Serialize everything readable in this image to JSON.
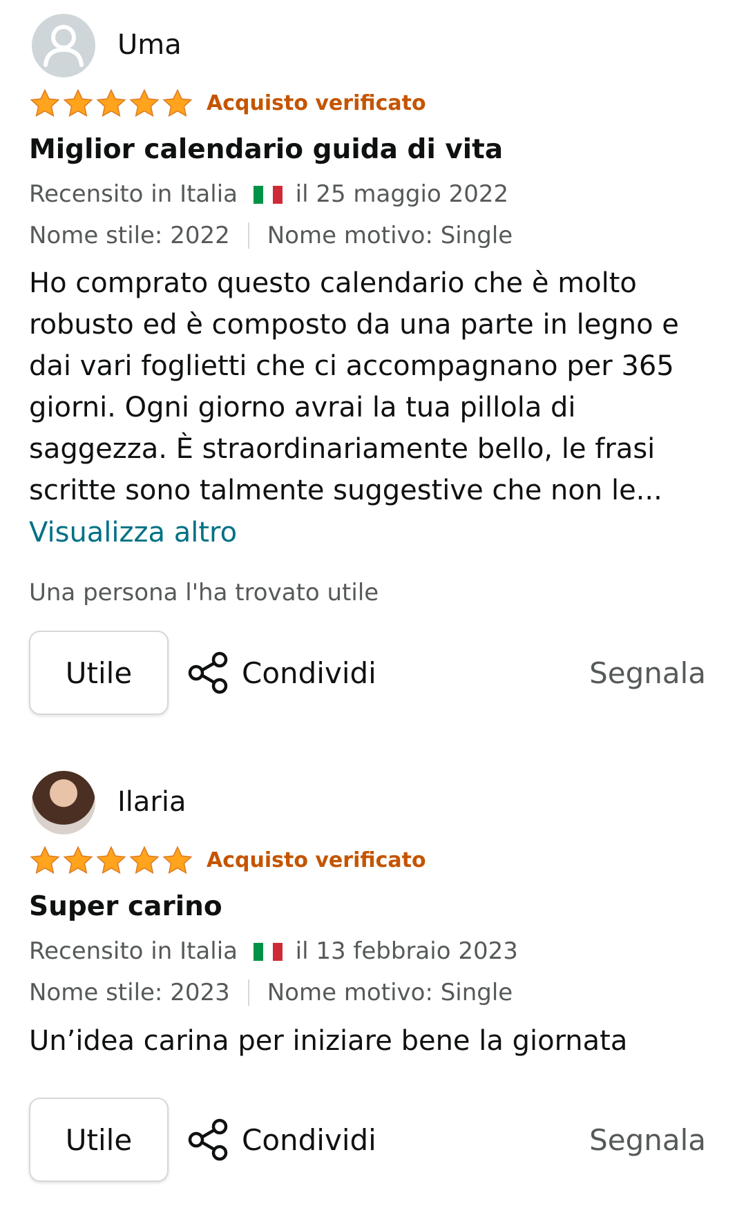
{
  "reviews": [
    {
      "author": "Uma",
      "avatar": "default-user-icon",
      "rating": 5,
      "verified": "Acquisto verificato",
      "title": "Miglior calendario guida di vita",
      "reviewed_prefix": "Recensito in Italia",
      "date": "il 25 maggio 2022",
      "style": "Nome stile: 2022",
      "pattern": "Nome motivo: Single",
      "body": "Ho comprato questo calendario che è molto robusto ed è composto da una parte in legno e dai vari foglietti che ci accompagnano per 365 giorni. Ogni giorno avrai la tua pillola di saggezza. È straordinariamente bello, le frasi scritte sono talmente suggestive che non le...",
      "more_link": "Visualizza altro",
      "helpful_text": "Una persona l'ha trovato utile",
      "helpful_button": "Utile",
      "share_label": "Condividi",
      "report_label": "Segnala"
    },
    {
      "author": "Ilaria",
      "avatar": "profile-photo",
      "rating": 5,
      "verified": "Acquisto verificato",
      "title": "Super carino",
      "reviewed_prefix": "Recensito in Italia",
      "date": "il 13 febbraio 2023",
      "style": "Nome stile: 2023",
      "pattern": "Nome motivo: Single",
      "body": "Un’idea carina per iniziare bene la giornata",
      "helpful_button": "Utile",
      "share_label": "Condividi",
      "report_label": "Segnala"
    }
  ],
  "colors": {
    "star": "#ffa41c",
    "verified": "#c45500",
    "link": "#007185",
    "muted": "#565959"
  }
}
